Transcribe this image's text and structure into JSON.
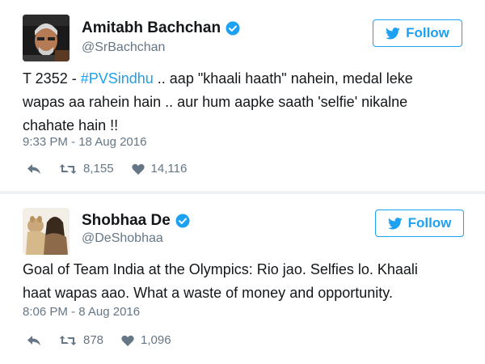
{
  "tweets": [
    {
      "display_name": "Amitabh Bachchan",
      "handle": "@SrBachchan",
      "verified": true,
      "follow_label": "Follow",
      "text": {
        "prefix": "T 2352 - ",
        "hashtag": "#PVSindhu",
        "line1_rest": " .. aap \"khaali haath\" nahein, medal leke",
        "line2": "wapas aa rahein hain .. aur hum aapke saath 'selfie' nikalne",
        "line3": "chahate hain !!"
      },
      "timestamp": "9:33 PM - 18 Aug 2016",
      "retweets": "8,155",
      "likes": "14,116",
      "icons": {
        "reply": "reply-icon",
        "retweet": "retweet-icon",
        "like": "heart-icon",
        "follow": "twitter-bird-icon",
        "verified": "verified-badge-icon"
      }
    },
    {
      "display_name": "Shobhaa De",
      "handle": "@DeShobhaa",
      "verified": true,
      "follow_label": "Follow",
      "text": {
        "line1": "Goal of Team India at the Olympics: Rio jao. Selfies lo. Khaali",
        "line2": "haat wapas aao. What a waste of money and opportunity."
      },
      "timestamp": "8:06 PM - 8 Aug 2016",
      "retweets": "878",
      "likes": "1,096",
      "icons": {
        "reply": "reply-icon",
        "retweet": "retweet-icon",
        "like": "heart-icon",
        "follow": "twitter-bird-icon",
        "verified": "verified-badge-icon"
      }
    }
  ],
  "colors": {
    "brand_blue": "#1da1f2",
    "text_primary": "#14171a",
    "text_secondary": "#657786",
    "divider": "#e1e8ed"
  }
}
